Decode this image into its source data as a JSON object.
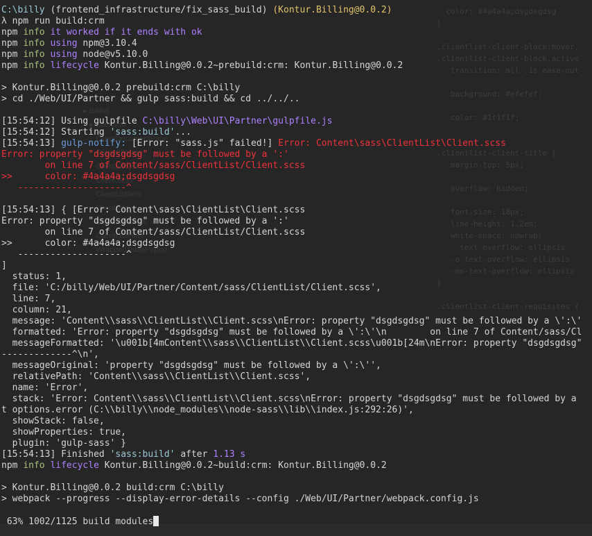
{
  "terminal": {
    "prompt_path": "C:\\billy",
    "prompt_branch": "(frontend_infrastructure/fix_sass_build)",
    "prompt_pkg": "(Kontur.Billing@0.0.2)",
    "command": "λ npm run build:crm",
    "npm": "npm",
    "info": "info",
    "l2_rest": "it worked if it ends with ok",
    "l3_using": "using",
    "l3_rest": "npm@3.10.4",
    "l4_rest": "node@v5.10.0",
    "lifecycle": "lifecycle",
    "l5_rest": "Kontur.Billing@0.0.2~prebuild:crm: Kontur.Billing@0.0.2",
    "l7": "> Kontur.Billing@0.0.2 prebuild:crm C:\\billy",
    "l8": "> cd ./Web/UI/Partner && gulp sass:build && cd ../../..",
    "t1": "[15:54:12]",
    "using_gulpfile": "Using gulpfile",
    "gulpfile_path": "C:\\billy\\Web\\UI\\Partner\\gulpfile.js",
    "starting": "Starting",
    "task_quoted": "'sass:build'",
    "ellipsis": "...",
    "t2": "[15:54:13]",
    "gulp_notify": "gulp-notify:",
    "notify_err": "[Error: \"sass.js\" failed!]",
    "notify_msg": "Error: Content\\sass\\ClientList\\Client.scss",
    "err_line1": "Error: property \"dsgdsgdsg\" must be followed by a ':'",
    "err_line2": "        on line 7 of Content/sass/ClientList/Client.scss",
    "err_line3": ">>      color: #4a4a4a;dsgdsgdsg",
    "err_line4": "   --------------------^",
    "obj_open": "[15:54:13] { [Error: Content\\sass\\ClientList\\Client.scss",
    "obj_bracket": "]",
    "status": "  status: 1,",
    "file": "  file: 'C:/billy/Web/UI/Partner/Content/sass/ClientList/Client.scss',",
    "line": "  line: 7,",
    "column": "  column: 21,",
    "message": "  message: 'Content\\\\sass\\\\ClientList\\\\Client.scss\\nError: property \"dsgdsgdsg\" must be followed by a \\':\\'",
    "formatted": "  formatted: 'Error: property \"dsgdsgdsg\" must be followed by a \\':\\'\\n        on line 7 of Content/sass/Cl",
    "messageFormatted": "  messageFormatted: '\\u001b[4mContent\\\\sass\\\\ClientList\\\\Client.scss\\u001b[24m\\nError: property \"dsgdsgdsg\"",
    "dashes": "-------------^\\n',",
    "messageOriginal": "  messageOriginal: 'property \"dsgdsgdsg\" must be followed by a \\':\\'',",
    "relativePath": "  relativePath: 'Content\\\\sass\\\\ClientList\\\\Client.scss',",
    "name": "  name: 'Error',",
    "stack": "  stack: 'Error: Content\\\\sass\\\\ClientList\\\\Client.scss\\nError: property \"dsgdsgdsg\" must be followed by a",
    "stack2": "t options.error (C:\\\\billy\\\\node_modules\\\\node-sass\\\\lib\\\\index.js:292:26)',",
    "showStack": "  showStack: false,",
    "showProperties": "  showProperties: true,",
    "plugin": "  plugin: 'gulp-sass' }",
    "finished": "Finished",
    "after": "after",
    "duration": "1.13 s",
    "l_build_rest": "Kontur.Billing@0.0.2~build:crm: Kontur.Billing@0.0.2",
    "build_cmd1": "> Kontur.Billing@0.0.2 build:crm C:\\billy",
    "build_cmd2": "> webpack --progress --display-error-details --config ./Web/UI/Partner/webpack.config.js",
    "progress": " 63% 1002/1125 build modules"
  },
  "colors": {
    "background": "#262626",
    "cyan": "#9ec9d6",
    "yellow": "#e3c46b",
    "green": "#a9c17a",
    "purple": "#ae81ff",
    "red": "#f0323c",
    "blue": "#6a9cd8"
  }
}
